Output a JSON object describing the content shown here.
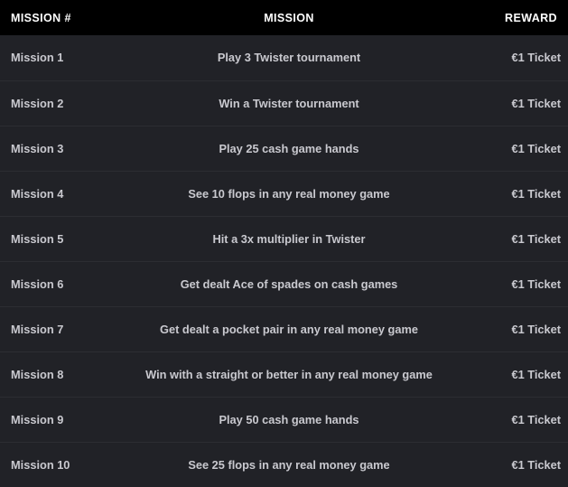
{
  "table": {
    "columns": [
      {
        "key": "number",
        "label": "MISSION #",
        "align": "left"
      },
      {
        "key": "mission",
        "label": "MISSION",
        "align": "center"
      },
      {
        "key": "reward",
        "label": "REWARD",
        "align": "right"
      }
    ],
    "header": {
      "number_label": "MISSION #",
      "mission_label": "MISSION",
      "reward_label": "REWARD"
    },
    "rows": [
      {
        "number": "Mission 1",
        "mission": "Play 3 Twister tournament",
        "reward": "€1 Ticket"
      },
      {
        "number": "Mission 2",
        "mission": "Win a Twister tournament",
        "reward": "€1 Ticket"
      },
      {
        "number": "Mission 3",
        "mission": "Play 25 cash game hands",
        "reward": "€1 Ticket"
      },
      {
        "number": "Mission 4",
        "mission": "See 10 flops in any real money game",
        "reward": "€1 Ticket"
      },
      {
        "number": "Mission 5",
        "mission": "Hit a 3x multiplier in Twister",
        "reward": "€1 Ticket"
      },
      {
        "number": "Mission 6",
        "mission": "Get dealt Ace of spades on cash games",
        "reward": "€1 Ticket"
      },
      {
        "number": "Mission 7",
        "mission": "Get dealt a pocket pair in any real money game",
        "reward": "€1 Ticket"
      },
      {
        "number": "Mission 8",
        "mission": "Win with a straight or better in any real money game",
        "reward": "€1 Ticket"
      },
      {
        "number": "Mission 9",
        "mission": "Play 50 cash game hands",
        "reward": "€1 Ticket"
      },
      {
        "number": "Mission 10",
        "mission": "See 25 flops in any real money game",
        "reward": "€1 Ticket"
      }
    ]
  },
  "colors": {
    "header_background": "#000000",
    "header_text": "#ffffff",
    "row_background": "#212227",
    "row_separator": "#2c2d32",
    "row_text": "#c9c9cf",
    "column_divider": "#3a3a3e"
  }
}
